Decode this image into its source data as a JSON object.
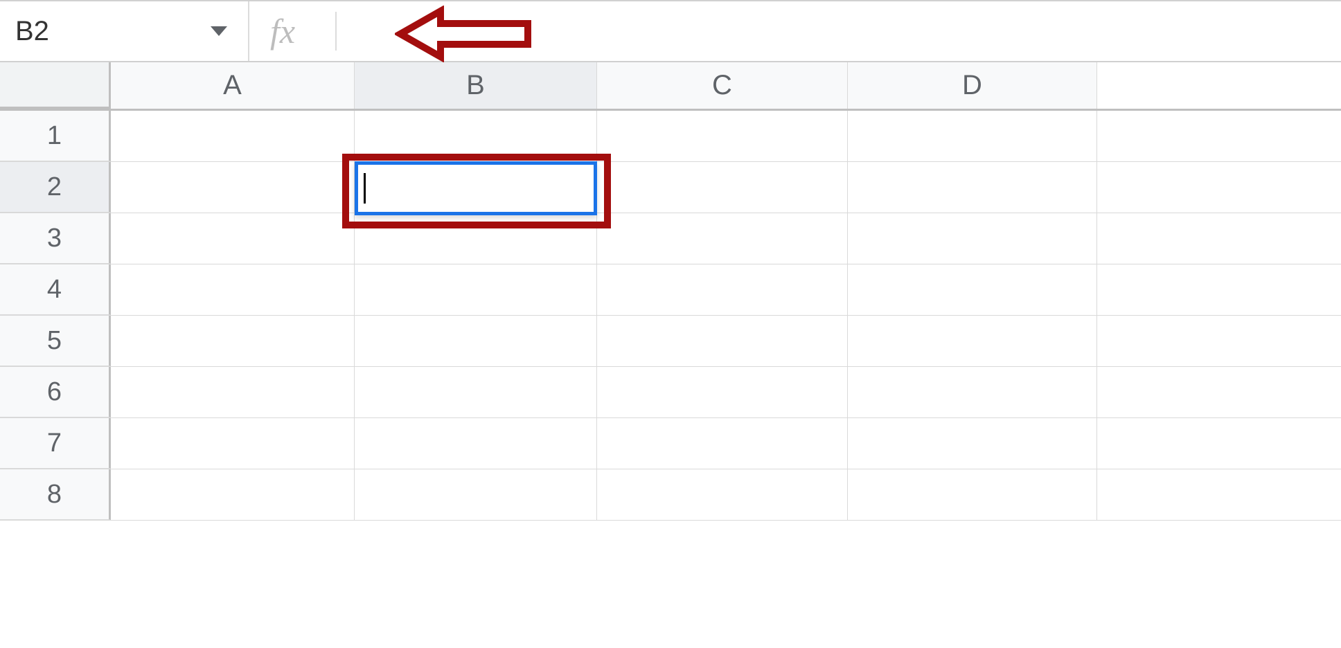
{
  "formulaBar": {
    "cellReference": "B2",
    "fxLabel": "fx",
    "formulaValue": ""
  },
  "columns": [
    "A",
    "B",
    "C",
    "D"
  ],
  "rows": [
    "1",
    "2",
    "3",
    "4",
    "5",
    "6",
    "7",
    "8"
  ],
  "selectedColumn": "B",
  "selectedRow": "2",
  "activeCell": {
    "value": ""
  },
  "annotations": {
    "arrowColor": "#a30e0e",
    "boxColor": "#a30e0e"
  }
}
